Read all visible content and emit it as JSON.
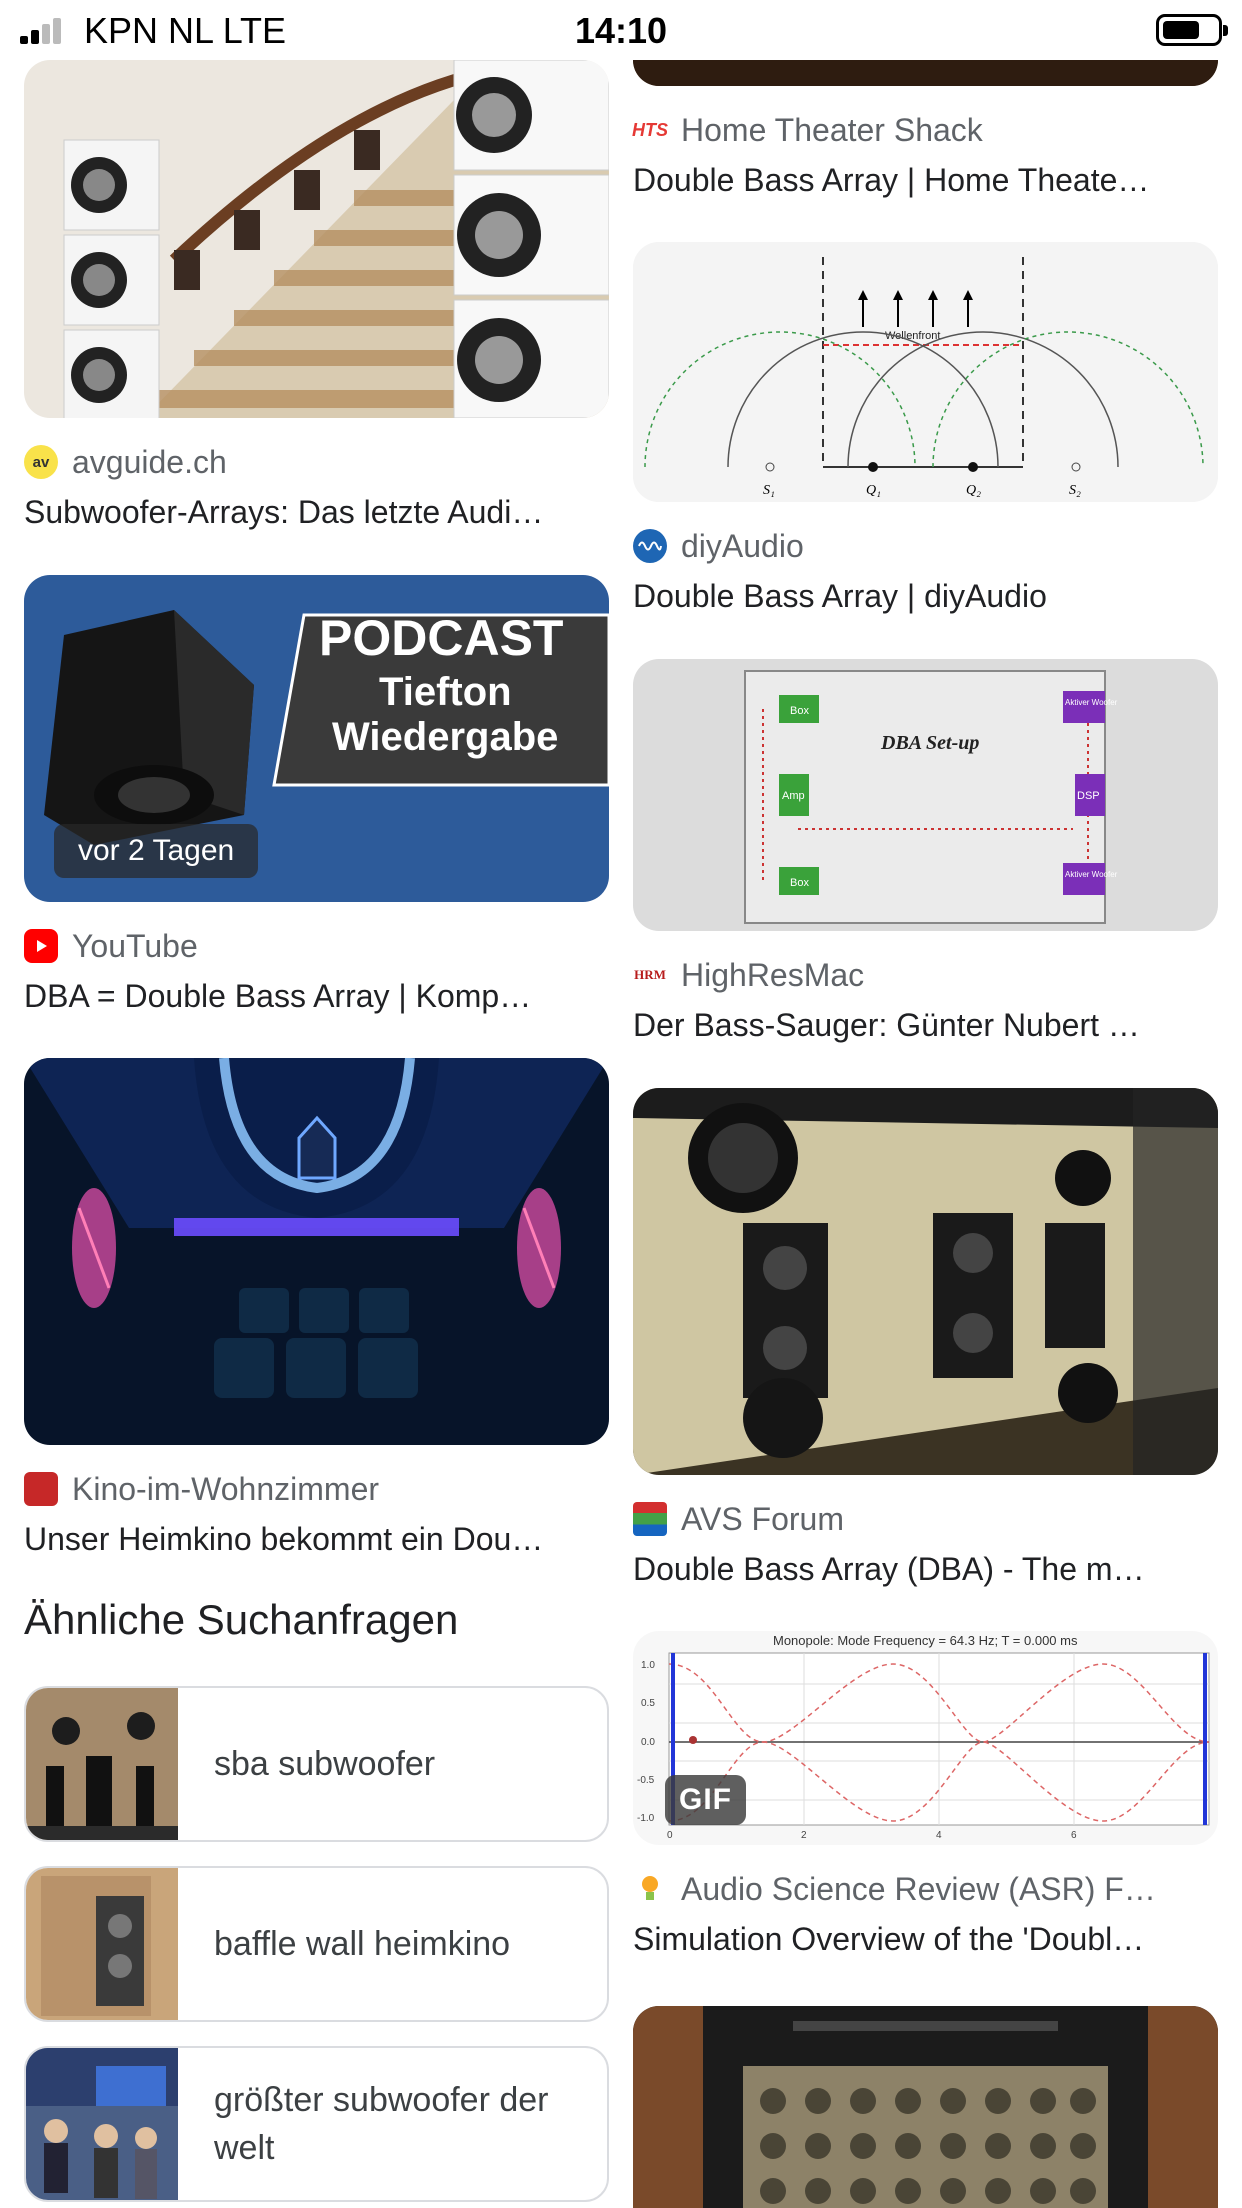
{
  "status_bar": {
    "carrier": "KPN NL   LTE",
    "time": "14:10"
  },
  "left_column": [
    {
      "source": "avguide.ch",
      "favicon_text": "av",
      "favicon_color": "#f9e24a",
      "title": "Subwoofer-Arrays: Das letzte Audi…"
    },
    {
      "source": "YouTube",
      "favicon_color": "#ff0000",
      "title": "DBA = Double Bass Array | Komp…",
      "badge": "vor 2 Tagen",
      "thumb_text": {
        "line1": "PODCAST",
        "line2": "Tiefton",
        "line3": "Wiedergabe"
      }
    },
    {
      "source": "Kino-im-Wohnzimmer",
      "favicon_color": "#c62828",
      "title": "Unser Heimkino bekommt ein Dou…"
    }
  ],
  "related": {
    "heading": "Ähnliche Suchanfragen",
    "items": [
      {
        "label": "sba subwoofer"
      },
      {
        "label": "baffle wall heimkino"
      },
      {
        "label": "größter subwoofer der welt"
      }
    ]
  },
  "right_column": [
    {
      "source": "Home Theater Shack",
      "favicon_text": "HTS",
      "favicon_color": "#e53935",
      "title": "Double Bass Array | Home Theate…"
    },
    {
      "source": "diyAudio",
      "favicon_color": "#1e66b4",
      "title": "Double Bass Array | diyAudio",
      "diagram": {
        "wavefront": "Wellenfront",
        "labels": [
          "S₁",
          "Q₁",
          "Q₂",
          "S₂"
        ]
      }
    },
    {
      "source": "HighResMac",
      "favicon_text": "HRM",
      "favicon_color": "#b71c1c",
      "title": "Der Bass-Sauger: Günter Nubert …",
      "diagram": {
        "heading": "DBA Set-up",
        "box1": "Box",
        "amp": "Amp",
        "box2": "Box",
        "aktiv1": "Aktiver Woofer",
        "dsp": "DSP",
        "aktiv2": "Aktiver Woofer"
      }
    },
    {
      "source": "AVS Forum",
      "favicon_color": "#1565c0",
      "title": "Double Bass Array (DBA) - The m…"
    },
    {
      "source": "Audio Science Review (ASR) F…",
      "favicon_color": "#f9a825",
      "title": "Simulation Overview of the 'Doubl…",
      "badge": "GIF",
      "plot": {
        "title": "Monopole: Mode Frequency = 64.3 Hz; T = 0.000 ms",
        "yticks": [
          "1.0",
          "0.5",
          "0.0",
          "-0.5",
          "-1.0"
        ],
        "xticks": [
          "0",
          "2",
          "4",
          "6"
        ]
      }
    }
  ]
}
